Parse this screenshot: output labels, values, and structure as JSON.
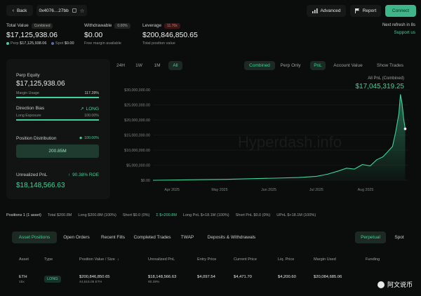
{
  "topbar": {
    "back_label": "Back",
    "address": "0x4076…27bb",
    "advanced_label": "Advanced",
    "report_label": "Report",
    "connect_label": "Connect"
  },
  "summary": {
    "total_value_label": "Total Value",
    "combined_badge": "Combined",
    "total_value": "$17,125,938.06",
    "perp_label": "Perp",
    "perp_value": "$17,125,938.06",
    "spot_label": "Spot",
    "spot_value": "$0.00",
    "withdrawable_label": "Withdrawable",
    "withdrawable_pct": "0.00%",
    "withdrawable_value": "$0.00",
    "withdrawable_sub": "Free margin available",
    "leverage_label": "Leverage",
    "leverage_badge": "11.70x",
    "leverage_value": "$200,846,850.65",
    "leverage_sub": "Total position value",
    "refresh_text": "Next refresh in 8s",
    "support_link": "Support us"
  },
  "left_panel": {
    "perp_equity_label": "Perp Equity",
    "perp_equity_value": "$17,125,938.06",
    "margin_usage_label": "Margin Usage",
    "margin_usage_value": "117.28%",
    "direction_bias_label": "Direction Bias",
    "direction_value": "LONG",
    "long_exposure_label": "Long Exposure",
    "long_exposure_value": "100.00%",
    "position_distribution_label": "Position Distribution",
    "position_distribution_pct": "100.00%",
    "distribution_bar_value": "200.85M",
    "distribution_fill_fraction": 1.0,
    "unrealized_pnl_label": "Unrealized PnL",
    "roe_value": "90.38% ROE",
    "unrealized_pnl_value": "$18,148,566.63"
  },
  "chart_controls": {
    "ranges": [
      "24H",
      "1W",
      "1M",
      "All"
    ],
    "active_range": "All",
    "modes": [
      "Combined",
      "Perp Only"
    ],
    "active_mode": "Combined",
    "metrics": [
      "PnL",
      "Account Value"
    ],
    "active_metric": "PnL",
    "show_trades_label": "Show Trades",
    "pnl_caption": "All PnL (Combined)",
    "pnl_total": "$17,045,319.25",
    "watermark_text": "Hyperdash.info"
  },
  "chart_data": {
    "type": "area",
    "title": "",
    "xlabel": "",
    "ylabel": "",
    "x_ticks": [
      "Apr 2025",
      "May 2025",
      "Jun 2025",
      "Jul 2025",
      "Aug 2025"
    ],
    "y_ticks": [
      "$0.00",
      "$5,000,000.00",
      "$10,000,000.00",
      "$15,000,000.00",
      "$20,000,000.00",
      "$25,000,000.00",
      "$30,000,000.00"
    ],
    "ylim": [
      0,
      30000000
    ],
    "grid": true,
    "color": "#3fd39a",
    "series": [
      {
        "x": [
          "2025-03-20",
          "2025-04-05",
          "2025-04-20",
          "2025-05-05",
          "2025-05-20",
          "2025-06-05",
          "2025-06-20",
          "2025-07-01",
          "2025-07-08",
          "2025-07-15",
          "2025-07-20",
          "2025-07-25",
          "2025-07-30",
          "2025-08-04",
          "2025-08-08",
          "2025-08-12",
          "2025-08-15",
          "2025-08-18",
          "2025-08-20",
          "2025-08-22",
          "2025-08-23",
          "2025-08-24",
          "2025-08-25",
          "2025-08-26"
        ],
        "values": [
          0,
          100000,
          200000,
          300000,
          500000,
          700000,
          900000,
          1300000,
          2000000,
          3100000,
          4000000,
          3700000,
          5200000,
          4800000,
          6800000,
          7800000,
          9500000,
          11200000,
          16000000,
          22000000,
          28500000,
          25500000,
          20500000,
          17045319
        ]
      }
    ]
  },
  "positions_strip": [
    "Positions 1 (1 asset)",
    "Total $200.8M",
    "Long $200.8M (100%)",
    "Short $0.0 (0%)",
    "Σ $+200.8M",
    "Long PnL $+18.1M (100%)",
    "Short PnL $0.0 (0%)",
    "UPnL $+18.1M (100%)"
  ],
  "bottom_tabs": {
    "items": [
      "Asset Positions",
      "Open Orders",
      "Recent Fills",
      "Completed Trades",
      "TWAP",
      "Deposits & Withdrawals"
    ],
    "active": "Asset Positions",
    "right_items": [
      "Perpetual",
      "Spot"
    ],
    "active_right": "Perpetual"
  },
  "table": {
    "headers": [
      "Asset",
      "Type",
      "Position Value / Size",
      "Unrealized PnL",
      "Entry Price",
      "Current Price",
      "Liq. Price",
      "Margin Used",
      "Funding"
    ],
    "rows": [
      {
        "asset": "ETH",
        "leverage": "15x",
        "type": "LONG",
        "position_value": "$200,846,850.65",
        "size": "44,616.05 ETH",
        "unrealized_pnl": "$18,148,566.63",
        "roe": "90.38%",
        "entry_price": "$4,097.54",
        "current_price": "$4,471.70",
        "liq_price": "$4,200.60",
        "margin_used": "$20,084,685.06",
        "funding": ""
      }
    ]
  },
  "watermark_brand": "阿文说币"
}
